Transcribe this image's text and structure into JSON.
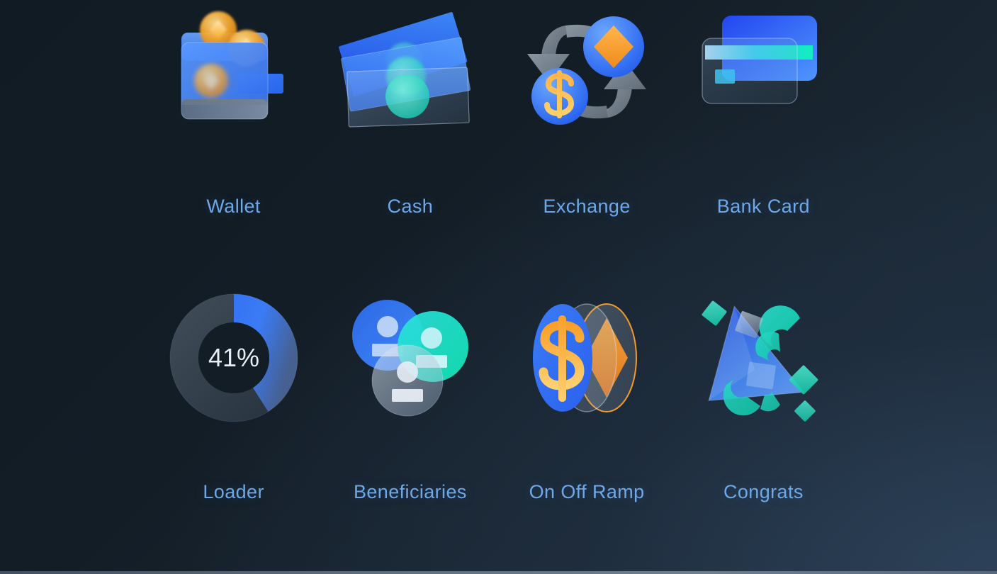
{
  "page": {
    "background_start": "#111b23",
    "background_end": "#22313f",
    "label_color": "#6ea8e8"
  },
  "palette": {
    "blue": "#2a6ef5",
    "blue_light": "#4f93ff",
    "cyan": "#18e6c8",
    "teal": "#1fd6b8",
    "orange": "#f5a623",
    "orange_deep": "#f07c1e",
    "gray": "#8e9aa6",
    "white": "#e8eef5"
  },
  "icons": [
    {
      "id": "wallet",
      "label": "Wallet",
      "row": 1,
      "col": 1
    },
    {
      "id": "cash",
      "label": "Cash",
      "row": 1,
      "col": 2
    },
    {
      "id": "exchange",
      "label": "Exchange",
      "row": 1,
      "col": 3
    },
    {
      "id": "bank-card",
      "label": "Bank Card",
      "row": 1,
      "col": 4
    },
    {
      "id": "loader",
      "label": "Loader",
      "row": 2,
      "col": 1
    },
    {
      "id": "beneficiaries",
      "label": "Beneficiaries",
      "row": 2,
      "col": 2
    },
    {
      "id": "on-off-ramp",
      "label": "On Off Ramp",
      "row": 2,
      "col": 3
    },
    {
      "id": "congrats",
      "label": "Congrats",
      "row": 2,
      "col": 4
    }
  ],
  "loader": {
    "percent_text": "41%",
    "percent_value": 41,
    "track_color": "#3a4personally",
    "arc_color": "#2f6df0"
  }
}
